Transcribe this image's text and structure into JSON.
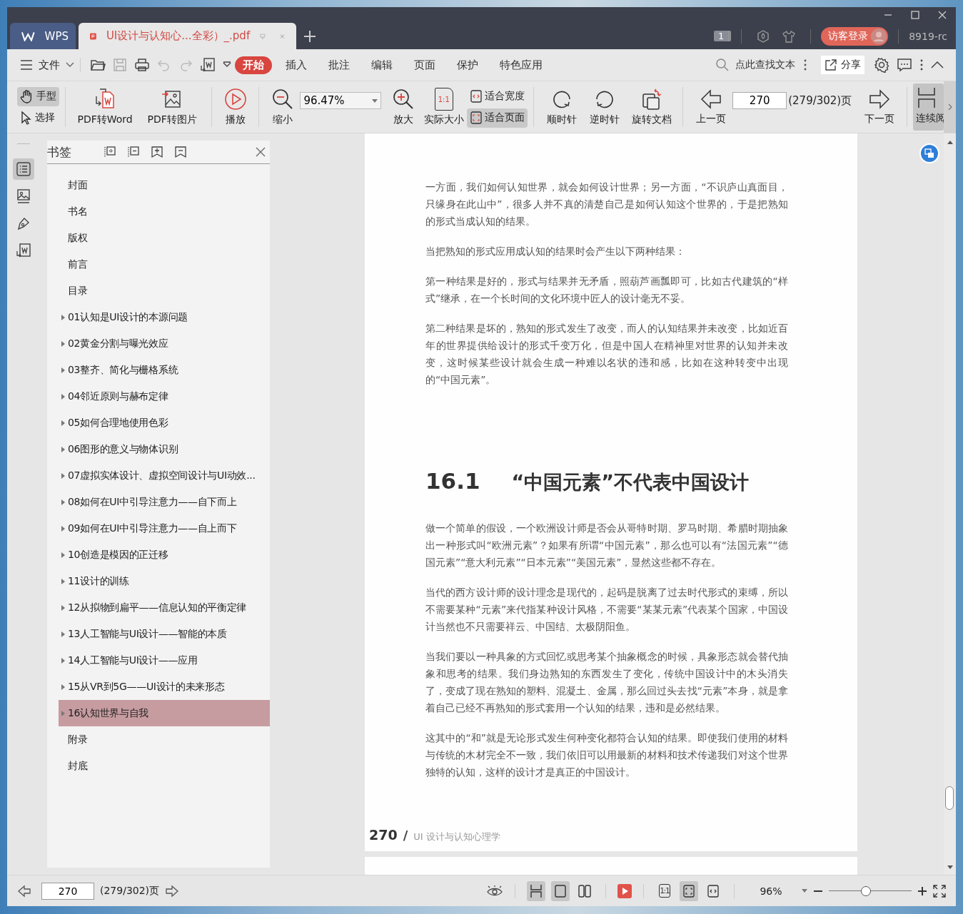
{
  "title_bar": {
    "tabs": [
      {
        "label": "WPS",
        "kind": "home",
        "selected": false
      },
      {
        "label": "UI设计与认知心...全彩）_.pdf",
        "kind": "document",
        "selected": true
      }
    ],
    "window_count": "1",
    "login": "访客登录",
    "user": "8919-rc"
  },
  "menu_bar": {
    "file": "文件",
    "tabs": [
      {
        "label": "开始",
        "selected": true
      },
      {
        "label": "插入",
        "selected": false
      },
      {
        "label": "批注",
        "selected": false
      },
      {
        "label": "编辑",
        "selected": false
      },
      {
        "label": "页面",
        "selected": false
      },
      {
        "label": "保护",
        "selected": false
      },
      {
        "label": "特色应用",
        "selected": false
      }
    ],
    "search": "点此查找文本",
    "share": "分享"
  },
  "toolbar": {
    "hand": {
      "label": "手型",
      "selected": true
    },
    "select": {
      "label": "选择",
      "selected": false
    },
    "pdf_to_word": "PDF转Word",
    "pdf_to_image": "PDF转图片",
    "play": "播放",
    "zoom_out": "缩小",
    "zoom_value": "96.47%",
    "zoom_in": "放大",
    "actual_size": "实际大小",
    "actual_size_icon": "1:1",
    "fit_width": {
      "label": "适合宽度",
      "selected": false
    },
    "fit_page": {
      "label": "适合页面",
      "selected": true
    },
    "clockwise": "顺时针",
    "counterclockwise": "逆时针",
    "rotate": "旋转文档",
    "prev_page": "上一页",
    "page": "270",
    "page_count": "(279/302)页",
    "next_page": "下一页",
    "continuous": {
      "label": "连续阅",
      "selected": true
    }
  },
  "side_rail": [
    {
      "kind": "bookmarks",
      "selected": true
    },
    {
      "kind": "thumbnails",
      "selected": false
    },
    {
      "kind": "annotations",
      "selected": false
    },
    {
      "kind": "convert",
      "selected": false
    }
  ],
  "bookmarks": {
    "title": "书签",
    "items": [
      {
        "label": "封面",
        "expandable": false,
        "selected": false
      },
      {
        "label": "书名",
        "expandable": false,
        "selected": false
      },
      {
        "label": "版权",
        "expandable": false,
        "selected": false
      },
      {
        "label": "前言",
        "expandable": false,
        "selected": false
      },
      {
        "label": "目录",
        "expandable": false,
        "selected": false
      },
      {
        "label": "01认知是UI设计的本源问题",
        "expandable": true,
        "selected": false
      },
      {
        "label": "02黄金分割与曝光效应",
        "expandable": true,
        "selected": false
      },
      {
        "label": "03整齐、简化与栅格系统",
        "expandable": true,
        "selected": false
      },
      {
        "label": "04邻近原则与赫布定律",
        "expandable": true,
        "selected": false
      },
      {
        "label": "05如何合理地使用色彩",
        "expandable": true,
        "selected": false
      },
      {
        "label": "06图形的意义与物体识别",
        "expandable": true,
        "selected": false
      },
      {
        "label": "07虚拟实体设计、虚拟空间设计与UI动效...",
        "expandable": true,
        "selected": false
      },
      {
        "label": "08如何在UI中引导注意力——自下而上",
        "expandable": true,
        "selected": false
      },
      {
        "label": "09如何在UI中引导注意力——自上而下",
        "expandable": true,
        "selected": false
      },
      {
        "label": "10创造是模因的正迁移",
        "expandable": true,
        "selected": false
      },
      {
        "label": "11设计的训练",
        "expandable": true,
        "selected": false
      },
      {
        "label": "12从拟物到扁平——信息认知的平衡定律",
        "expandable": true,
        "selected": false
      },
      {
        "label": "13人工智能与UI设计——智能的本质",
        "expandable": true,
        "selected": false
      },
      {
        "label": "14人工智能与UI设计——应用",
        "expandable": true,
        "selected": false
      },
      {
        "label": "15从VR到5G——UI设计的未来形态",
        "expandable": true,
        "selected": false
      },
      {
        "label": "16认知世界与自我",
        "expandable": true,
        "selected": true
      },
      {
        "label": "附录",
        "expandable": false,
        "selected": false
      },
      {
        "label": "封底",
        "expandable": false,
        "selected": false
      }
    ]
  },
  "document": {
    "paragraphs_before": [
      "一方面，我们如何认知世界，就会如何设计世界；另一方面，“不识庐山真面目，只缘身在此山中”，很多人并不真的清楚自己是如何认知这个世界的，于是把熟知的形式当成认知的结果。",
      "当把熟知的形式应用成认知的结果时会产生以下两种结果：",
      "第一种结果是好的，形式与结果并无矛盾，照葫芦画瓢即可，比如古代建筑的“样式”继承，在一个长时间的文化环境中匠人的设计毫无不妥。",
      "第二种结果是坏的，熟知的形式发生了改变，而人的认知结果并未改变，比如近百年的世界提供给设计的形式千变万化，但是中国人在精神里对世界的认知并未改变，这时候某些设计就会生成一种难以名状的违和感，比如在这种转变中出现的“中国元素”。"
    ],
    "section_number": "16.1",
    "section_title": "“中国元素”不代表中国设计",
    "paragraphs_after": [
      "做一个简单的假设，一个欧洲设计师是否会从哥特时期、罗马时期、希腊时期抽象出一种形式叫“欧洲元素”？如果有所谓“中国元素”，那么也可以有“法国元素”“德国元素”“意大利元素”“日本元素”“美国元素”，显然这些都不存在。",
      "当代的西方设计师的设计理念是现代的，起码是脱离了过去时代形式的束缚，所以不需要某种“元素”来代指某种设计风格，不需要“某某元素”代表某个国家，中国设计当然也不只需要祥云、中国结、太极阴阳鱼。",
      "当我们要以一种具象的方式回忆或思考某个抽象概念的时候，具象形态就会替代抽象和思考的结果。我们身边熟知的东西发生了变化，传统中国设计中的木头消失了，变成了现在熟知的塑料、混凝土、金属，那么回过头去找“元素”本身，就是拿着自己已经不再熟知的形式套用一个认知的结果，违和是必然结果。",
      "这其中的“和”就是无论形式发生何种变化都符合认知的结果。即使我们使用的材料与传统的木材完全不一致，我们依旧可以用最新的材料和技术传递我们对这个世界独特的认知，这样的设计才是真正的中国设计。"
    ],
    "footer_page": "270",
    "footer_separator": "/",
    "footer_title": "UI 设计与认知心理学"
  },
  "status_bar": {
    "page": "270",
    "page_count": "(279/302)页",
    "view_modes": [
      {
        "kind": "continuous",
        "selected": true
      },
      {
        "kind": "single",
        "selected": true
      },
      {
        "kind": "double",
        "selected": false
      }
    ],
    "fit_modes": [
      {
        "kind": "actual",
        "label": "1:1",
        "selected": false
      },
      {
        "kind": "page",
        "selected": true
      },
      {
        "kind": "width",
        "selected": false
      }
    ],
    "zoom": "96%",
    "zoom_slider": {
      "level": 0.45
    }
  }
}
